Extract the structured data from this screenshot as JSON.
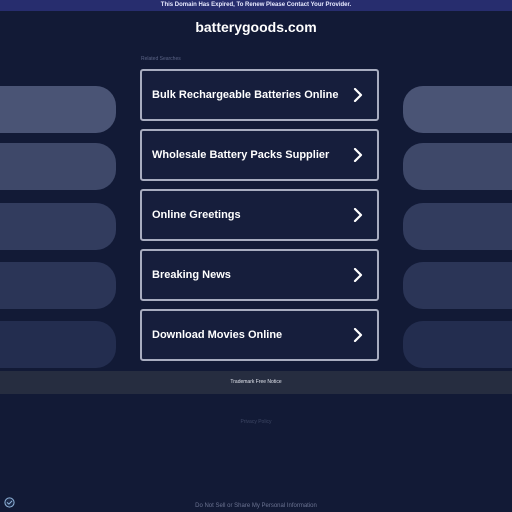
{
  "banner": {
    "text": "This Domain Has Expired, To Renew Please Contact Your Provider."
  },
  "header": {
    "domain": "batterygoods.com"
  },
  "related": {
    "label": "Related Searches",
    "items": [
      {
        "label": "Bulk Rechargeable Batteries Online",
        "icon": "chevron-right-icon"
      },
      {
        "label": "Wholesale Battery Packs Supplier",
        "icon": "chevron-right-icon"
      },
      {
        "label": "Online Greetings",
        "icon": "chevron-right-icon"
      },
      {
        "label": "Breaking News",
        "icon": "chevron-right-icon"
      },
      {
        "label": "Download Movies Online",
        "icon": "chevron-right-icon"
      }
    ]
  },
  "footer": {
    "trademark": "Trademark Free Notice",
    "privacy": "Privacy Policy",
    "dnsmpi": "Do Not Sell or Share My Personal Information"
  },
  "colors": {
    "background": "#121a36",
    "banner": "#272d6e",
    "link_border": "#a8adc0",
    "footer_bar": "#262d40"
  }
}
